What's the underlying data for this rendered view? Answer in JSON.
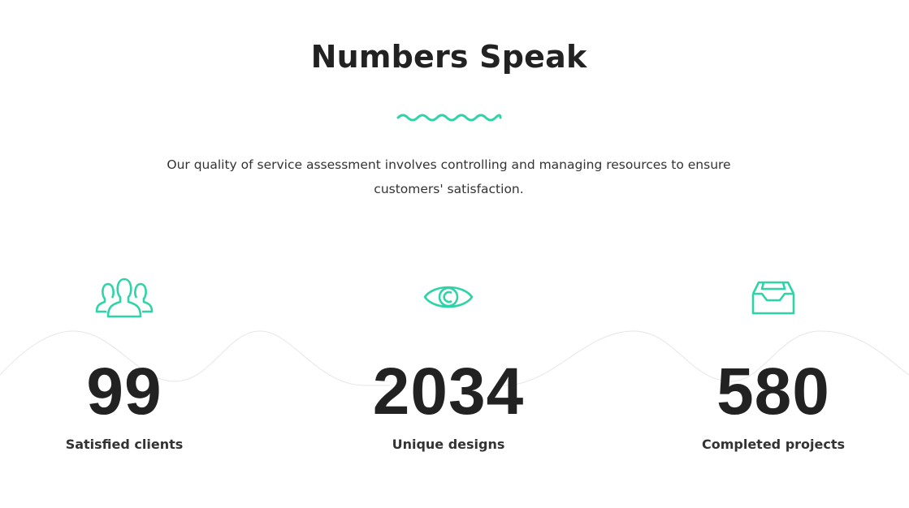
{
  "section": {
    "title": "Numbers Speak",
    "description": "Our quality of service assessment involves controlling and managing resources to ensure customers' satisfaction."
  },
  "colors": {
    "accent": "#2ed3a7",
    "text": "#222222",
    "wave": "#e6e6e6"
  },
  "stats": [
    {
      "icon": "users-icon",
      "value": "99",
      "label": "Satisfied clients"
    },
    {
      "icon": "eye-icon",
      "value": "2034",
      "label": "Unique designs"
    },
    {
      "icon": "inbox-icon",
      "value": "580",
      "label": "Completed projects"
    }
  ]
}
